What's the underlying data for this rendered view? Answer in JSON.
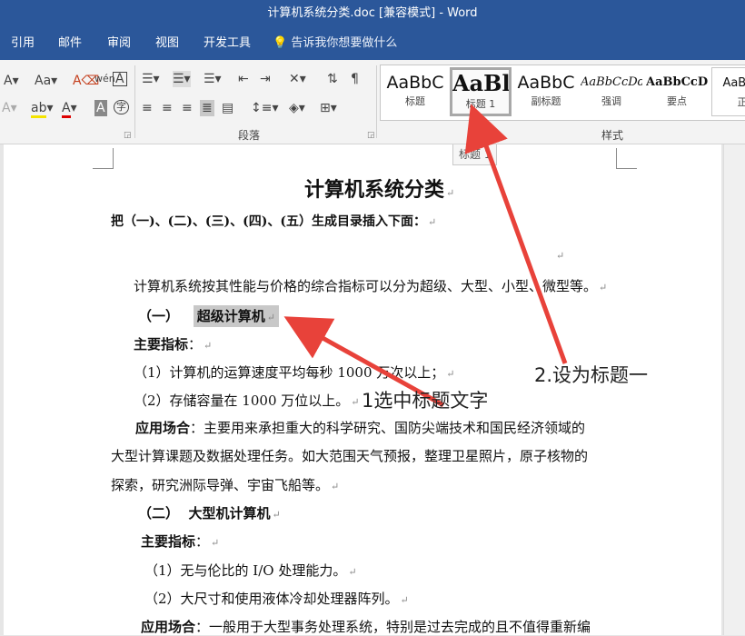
{
  "window": {
    "title": "计算机系统分类.doc [兼容模式] - Word"
  },
  "menu": {
    "items": [
      "引用",
      "邮件",
      "审阅",
      "视图",
      "开发工具"
    ],
    "tell_me": "告诉我你想要做什么"
  },
  "ribbon": {
    "font_group": {
      "clear_format": "Aa",
      "phonetic": "wén",
      "enclose": "字"
    },
    "paragraph_group_label": "段落",
    "styles_group_label": "样式",
    "styles": [
      {
        "sample": "AaBbC",
        "name": "标题"
      },
      {
        "sample": "AaBl",
        "name": "标题 1"
      },
      {
        "sample": "AaBbC",
        "name": "副标题"
      },
      {
        "sample": "AaBbCcDd",
        "name": "强调"
      },
      {
        "sample": "AaBbCcD",
        "name": "要点"
      },
      {
        "sample": "AaBbC",
        "name": "正"
      }
    ]
  },
  "style_tag": "标题 1",
  "document": {
    "title": "计算机系统分类",
    "instruction": "把（一)、(二)、(三)、(四)、(五）生成目录插入下面：",
    "intro": "计算机系统按其性能与价格的综合指标可以分为超级、大型、小型、微型等。",
    "h1": {
      "num": "（一）",
      "text": "超级计算机"
    },
    "h1_label": "主要指标",
    "h1_item1": "（1）计算机的运算速度平均每秒 1000 万次以上；",
    "h1_item2": "（2）存储容量在 1000 万位以上。",
    "h1_app_label": "应用场合",
    "h1_app_line1": "：主要用来承担重大的科学研究、国防尖端技术和国民经济领域的",
    "h1_app_line2": "大型计算课题及数据处理任务。如大范围天气预报，整理卫星照片，原子核物的",
    "h1_app_line3": "探索，研究洲际导弹、宇宙飞船等。",
    "h2": {
      "num": "（二）",
      "text": "大型机计算机"
    },
    "h2_label": "主要指标",
    "h2_item1": "（1）无与伦比的 I/O 处理能力。",
    "h2_item2": "（2）大尺寸和使用液体冷却处理器阵列。",
    "h2_app_label": "应用场合",
    "h2_app_line1": "：一般用于大型事务处理系统，特别是过去完成的且不值得重新编"
  },
  "annotations": {
    "step1": "1选中标题文字",
    "step2": "2.设为标题一",
    "arrow_color": "#e8423a"
  },
  "colors": {
    "titlebar": "#2b579a",
    "ribbon": "#f3f3f3"
  }
}
